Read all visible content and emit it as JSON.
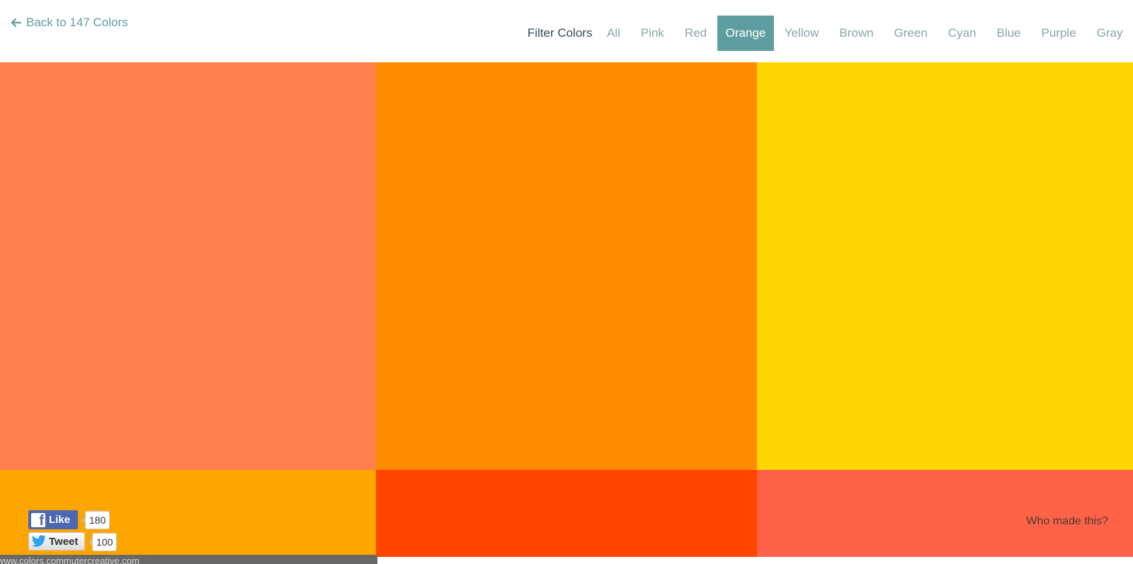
{
  "header": {
    "back_link": "Back to 147 Colors",
    "filter_label": "Filter Colors",
    "filters": [
      "All",
      "Pink",
      "Red",
      "Orange",
      "Yellow",
      "Brown",
      "Green",
      "Cyan",
      "Blue",
      "Purple",
      "Gray"
    ],
    "active_filter": "Orange"
  },
  "swatches": [
    {
      "color": "#ff7f50"
    },
    {
      "color": "#ff8c00"
    },
    {
      "color": "#ffd700"
    },
    {
      "color": "#ffa500"
    },
    {
      "color": "#ff4500"
    },
    {
      "color": "#ff6347"
    }
  ],
  "social": {
    "like_label": "Like",
    "like_count": "180",
    "tweet_label": "Tweet",
    "tweet_count": "100"
  },
  "footer": {
    "who_made": "Who made this?"
  },
  "status_bar": {
    "url": "www.colors.commutercreative.com"
  },
  "colors": {
    "accent": "#5f9ea0",
    "link": "#5e9ea0",
    "nav_text": "#8aa4a8"
  }
}
